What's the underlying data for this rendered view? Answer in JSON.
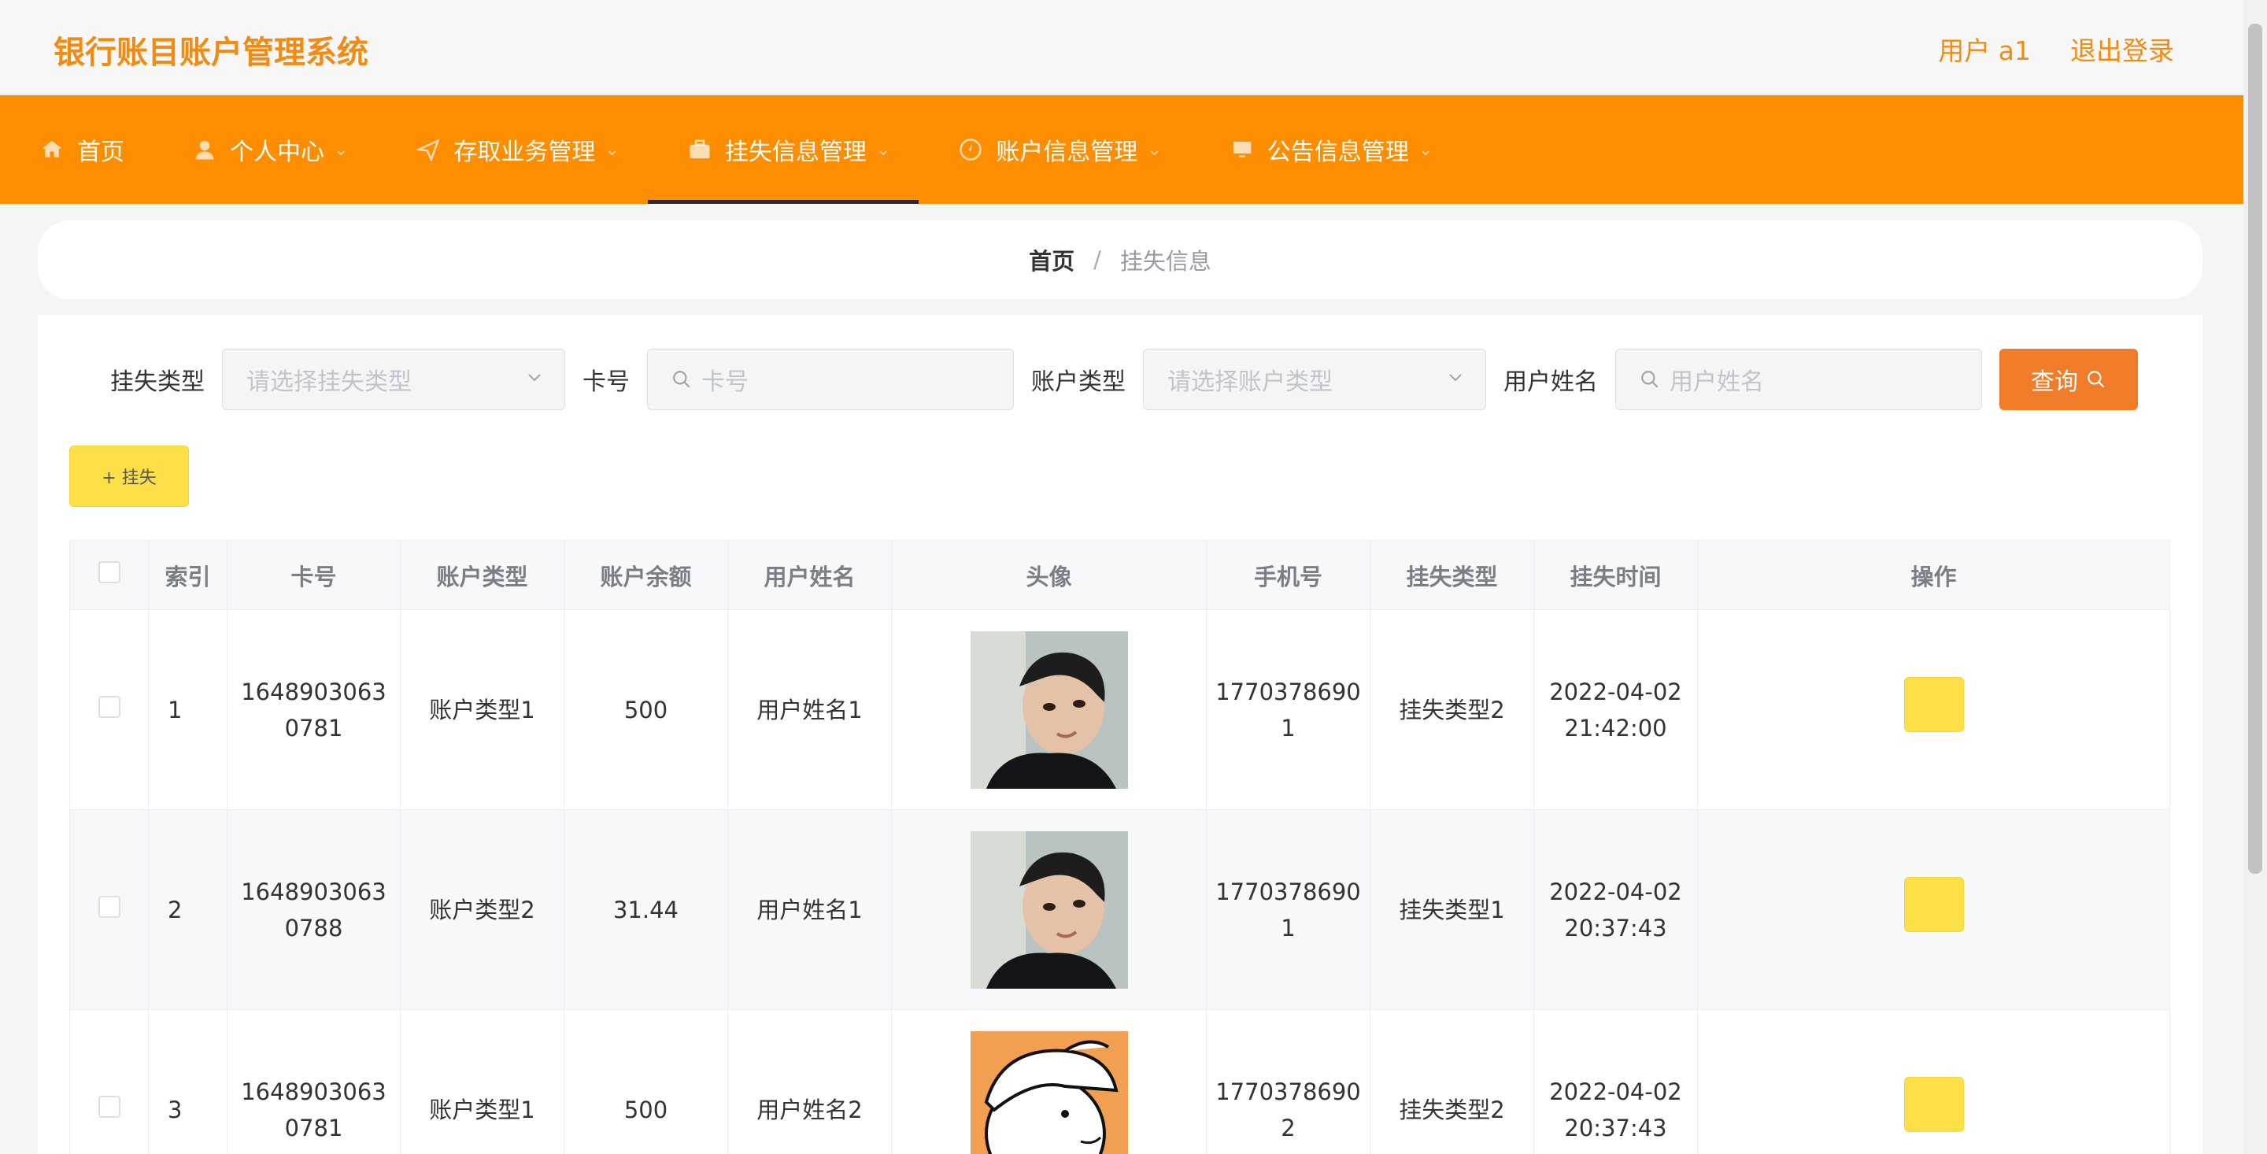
{
  "header": {
    "app_title": "银行账目账户管理系统",
    "user_label": "用户 a1",
    "logout_label": "退出登录"
  },
  "nav": {
    "items": [
      {
        "label": "首页",
        "icon": "home-icon",
        "has_caret": false
      },
      {
        "label": "个人中心",
        "icon": "user-icon",
        "has_caret": true
      },
      {
        "label": "存取业务管理",
        "icon": "send-icon",
        "has_caret": true
      },
      {
        "label": "挂失信息管理",
        "icon": "briefcase-icon",
        "has_caret": true,
        "active": true
      },
      {
        "label": "账户信息管理",
        "icon": "compass-icon",
        "has_caret": true
      },
      {
        "label": "公告信息管理",
        "icon": "monitor-icon",
        "has_caret": true
      }
    ]
  },
  "breadcrumb": {
    "home": "首页",
    "separator": "/",
    "current": "挂失信息"
  },
  "search": {
    "loss_type_label": "挂失类型",
    "loss_type_placeholder": "请选择挂失类型",
    "card_no_label": "卡号",
    "card_no_placeholder": "卡号",
    "account_type_label": "账户类型",
    "account_type_placeholder": "请选择账户类型",
    "user_name_label": "用户姓名",
    "user_name_placeholder": "用户姓名",
    "query_label": "查询"
  },
  "actions": {
    "add_label": "+ 挂失"
  },
  "table": {
    "columns": [
      "",
      "索引",
      "卡号",
      "账户类型",
      "账户余额",
      "用户姓名",
      "头像",
      "手机号",
      "挂失类型",
      "挂失时间",
      "操作"
    ],
    "rows": [
      {
        "index": "1",
        "card_no": "16489030630781",
        "account_type": "账户类型1",
        "balance": "500",
        "user_name": "用户姓名1",
        "avatar": "man-portrait",
        "phone": "17703786901",
        "loss_type": "挂失类型2",
        "time": "2022-04-02 21:42:00"
      },
      {
        "index": "2",
        "card_no": "16489030630788",
        "account_type": "账户类型2",
        "balance": "31.44",
        "user_name": "用户姓名1",
        "avatar": "man-portrait",
        "phone": "17703786901",
        "loss_type": "挂失类型1",
        "time": "2022-04-02 20:37:43"
      },
      {
        "index": "3",
        "card_no": "16489030630781",
        "account_type": "账户类型1",
        "balance": "500",
        "user_name": "用户姓名2",
        "avatar": "cartoon-kid",
        "phone": "17703786902",
        "loss_type": "挂失类型2",
        "time": "2022-04-02 20:37:43"
      }
    ],
    "card_no_split": [
      [
        "1648903063",
        "0781"
      ],
      [
        "1648903063",
        "0788"
      ],
      [
        "1648903063",
        "0781"
      ]
    ],
    "phone_split": [
      [
        "1770378690",
        "1"
      ],
      [
        "1770378690",
        "1"
      ],
      [
        "1770378690",
        "2"
      ]
    ],
    "time_split": [
      [
        "2022-04-02",
        "21:42:00"
      ],
      [
        "2022-04-02",
        "20:37:43"
      ],
      [
        "2022-04-02",
        "20:37:43"
      ]
    ]
  },
  "colors": {
    "brand": "#ff8d00",
    "title": "#f28b12",
    "query_button": "#f07c2a",
    "add_button": "#fde047"
  }
}
